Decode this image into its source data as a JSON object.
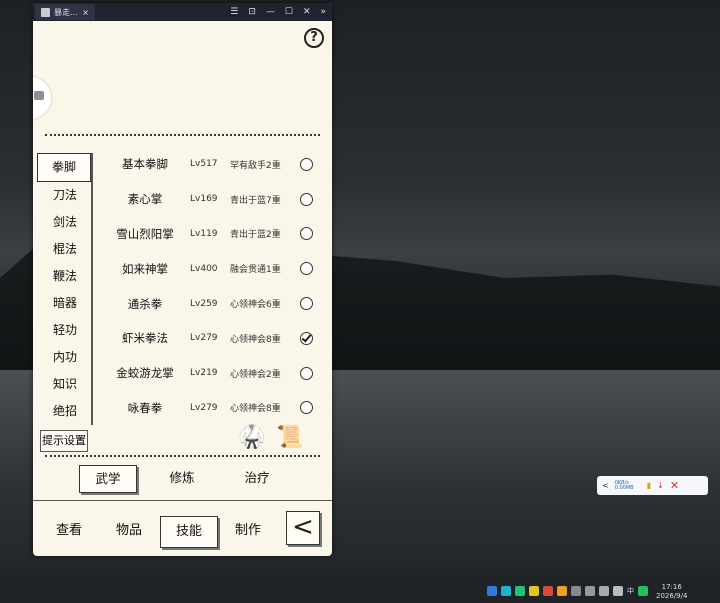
{
  "window": {
    "tab_title": "暴走...",
    "close_tab": "×",
    "controls": [
      "☰",
      "⊡",
      "—",
      "☐",
      "✕",
      "»"
    ]
  },
  "help": "?",
  "categories": [
    "拳脚",
    "刀法",
    "剑法",
    "棍法",
    "鞭法",
    "暗器",
    "轻功",
    "内功",
    "知识",
    "绝招"
  ],
  "hint_button": "提示设置",
  "skills": [
    {
      "name": "基本拳脚",
      "level": "Lv517",
      "rank": "罕有敌手2重",
      "checked": false
    },
    {
      "name": "素心掌",
      "level": "Lv169",
      "rank": "青出于蓝7重",
      "checked": false
    },
    {
      "name": "雪山烈阳掌",
      "level": "Lv119",
      "rank": "青出于蓝2重",
      "checked": false
    },
    {
      "name": "如来神掌",
      "level": "Lv400",
      "rank": "融会贯通1重",
      "checked": false
    },
    {
      "name": "通杀拳",
      "level": "Lv259",
      "rank": "心领神会6重",
      "checked": false
    },
    {
      "name": "虾米拳法",
      "level": "Lv279",
      "rank": "心领神会8重",
      "checked": true
    },
    {
      "name": "金蛟游龙掌",
      "level": "Lv219",
      "rank": "心领神会2重",
      "checked": false
    },
    {
      "name": "咏春拳",
      "level": "Lv279",
      "rank": "心领神会8重",
      "checked": false
    }
  ],
  "subtabs": [
    "武学",
    "修炼",
    "治疗"
  ],
  "bottom_nav": [
    "查看",
    "物品",
    "技能",
    "制作"
  ],
  "back": "<",
  "widget": {
    "back": "<",
    "line1": "0KB/s",
    "line2": "0.00MB"
  },
  "taskbar": {
    "time": "17:16",
    "date": "2026/9/4",
    "ime": "中"
  }
}
